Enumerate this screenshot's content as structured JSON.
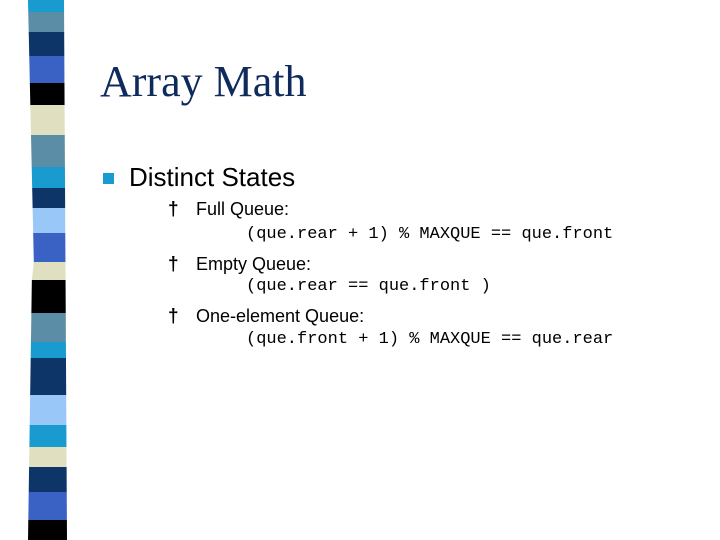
{
  "slide": {
    "title": "Array Math",
    "bullet": {
      "text": "Distinct States",
      "marker_color": "#1a9bd0",
      "subitems": [
        {
          "marker": "†",
          "label": "Full Queue:",
          "code": "(que.rear + 1) % MAXQUE == que.front"
        },
        {
          "marker": "†",
          "label": "Empty Queue:",
          "code": "(que.rear == que.front )"
        },
        {
          "marker": "†",
          "label": "One-element Queue:",
          "code": "(que.front + 1) % MAXQUE == que.rear"
        }
      ]
    },
    "title_color": "#0f2a5c",
    "stripe_colors": [
      "#1a9bd0",
      "#5b8ea6",
      "#0d3568",
      "#3a62c4",
      "#000000",
      "#e0e0c0",
      "#5b8ea6",
      "#1a9bd0",
      "#0d3568",
      "#99c8f8",
      "#3a62c4",
      "#e0e0c0",
      "#000000",
      "#5b8ea6",
      "#1a9bd0",
      "#0d3568",
      "#99c8f8",
      "#1a9bd0",
      "#e0e0c0",
      "#0d3568",
      "#3a62c4",
      "#000000"
    ]
  }
}
